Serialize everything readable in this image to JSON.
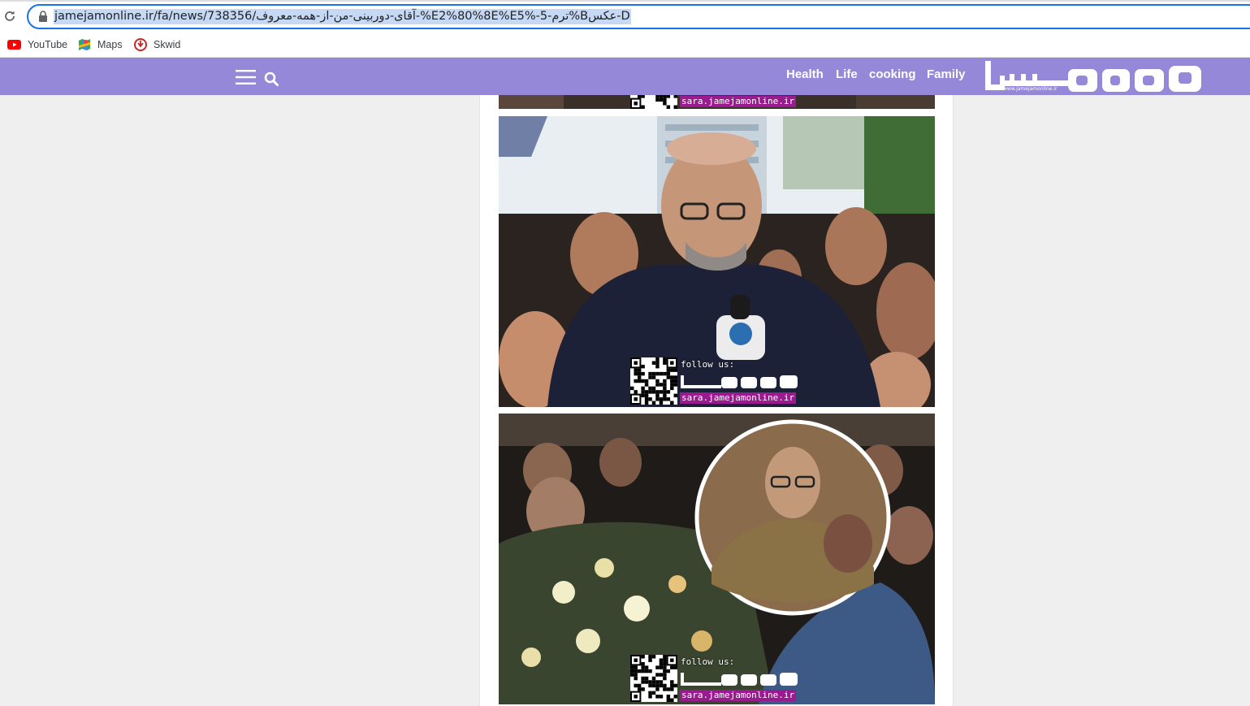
{
  "browser": {
    "url": "jamejamonline.ir/fa/news/738356/عکس-5%B-ترم-5%E5%80%E2%آقای-دوربینی-من-از-همه-معروف",
    "url_display": "jamejamonline.ir/fa/news/738356/آقای-دوربینی-من-از-همه-معروف-%E2%80%8E%E5%-ترم-5%Bعکس-D"
  },
  "bookmarks": [
    {
      "label": "YouTube",
      "icon": "youtube-icon"
    },
    {
      "label": "Maps",
      "icon": "maps-icon"
    },
    {
      "label": "Skwid",
      "icon": "skwid-icon"
    }
  ],
  "header": {
    "nav": [
      "Health",
      "Life",
      "cooking",
      "Family"
    ],
    "logo_url": "www.jamejamonline.ir",
    "bg_color": "#9588d8"
  },
  "watermark": {
    "follow": "follow us:",
    "site": "sara.jamejamonline.ir"
  }
}
